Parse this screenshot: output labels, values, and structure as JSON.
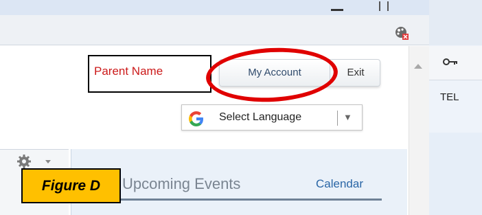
{
  "header": {
    "parent_name": "Parent Name",
    "my_account_label": "My Account",
    "exit_label": "Exit"
  },
  "translate": {
    "label": "Select Language",
    "arrow": "▼"
  },
  "side_panel": {
    "tel_label": "TEL"
  },
  "events": {
    "title": "Upcoming Events",
    "calendar_link": "Calendar"
  },
  "annotation": {
    "figure_label": "Figure D",
    "highlight_color": "#e00000",
    "label_background": "#ffc000"
  },
  "colors": {
    "parent_name": "#cc1a1a",
    "link": "#2a66a6"
  }
}
